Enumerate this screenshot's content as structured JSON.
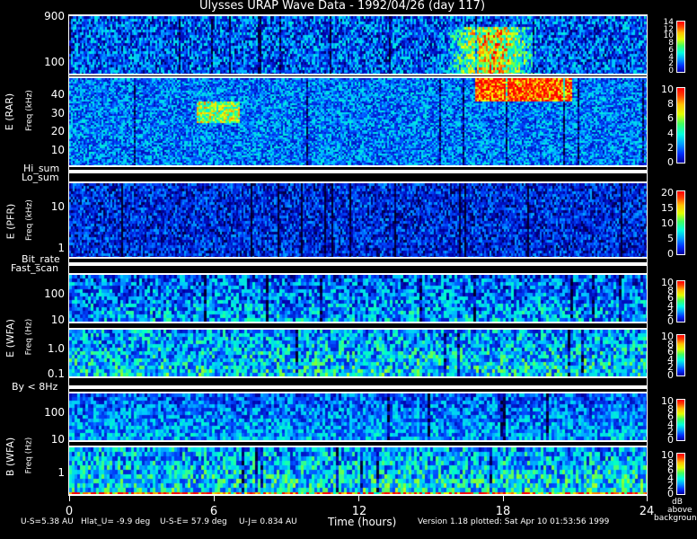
{
  "title": "Ulysses URAP Wave Data - 1992/04/26  (day 117)",
  "chart_data": {
    "type": "heatmap",
    "title": "Ulysses URAP Wave Data - 1992/04/26  (day 117)",
    "xlabel": "Time (hours)",
    "xlim": [
      0,
      24
    ],
    "xticks": [
      "0",
      "6",
      "12",
      "18",
      "24"
    ],
    "colorbar_unit": [
      "dB",
      "above",
      "background"
    ],
    "panels": [
      {
        "name": "E (RAR) high",
        "ylabel": "E (RAR)",
        "yunit": "Freq (kHz)",
        "yticks": [
          "900",
          "100"
        ],
        "cbar_ticks": [
          "0",
          "2",
          "4",
          "6",
          "8",
          "10",
          "12",
          "14"
        ],
        "crange": [
          0,
          14
        ]
      },
      {
        "name": "E (RAR) low",
        "ylabel": "E (RAR)",
        "yunit": "Freq (kHz)",
        "yticks": [
          "40",
          "30",
          "20",
          "10"
        ],
        "cbar_ticks": [
          "0",
          "2",
          "4",
          "6",
          "8",
          "10"
        ],
        "crange": [
          0,
          10
        ]
      },
      {
        "name": "E (PFR)",
        "ylabel": "E (PFR)",
        "yunit": "Freq (kHz)",
        "yticks": [
          "10",
          "1"
        ],
        "cbar_ticks": [
          "0",
          "5",
          "10",
          "15",
          "20"
        ],
        "crange": [
          0,
          20
        ]
      },
      {
        "name": "E (WFA) high",
        "ylabel": "E (WFA)",
        "yunit": "Freq (Hz)",
        "yticks": [
          "100",
          "10"
        ],
        "cbar_ticks": [
          "0",
          "2",
          "4",
          "6",
          "8",
          "10"
        ],
        "crange": [
          0,
          10
        ]
      },
      {
        "name": "E (WFA) low",
        "ylabel": "E (WFA)",
        "yunit": "Freq (Hz)",
        "yticks": [
          "1.0",
          "0.1"
        ],
        "cbar_ticks": [
          "0",
          "2",
          "4",
          "6",
          "8",
          "10"
        ],
        "crange": [
          0,
          10
        ]
      },
      {
        "name": "B (WFA) high",
        "ylabel": "B (WFA)",
        "yunit": "Freq (Hz)",
        "yticks": [
          "100",
          "10"
        ],
        "cbar_ticks": [
          "0",
          "2",
          "4",
          "6",
          "8",
          "10"
        ],
        "crange": [
          0,
          10
        ]
      },
      {
        "name": "B (WFA) low",
        "ylabel": "B (WFA)",
        "yunit": "Freq (Hz)",
        "yticks": [
          "1"
        ],
        "cbar_ticks": [
          "0",
          "2",
          "4",
          "6",
          "8",
          "10"
        ],
        "crange": [
          0,
          10
        ]
      }
    ],
    "status_bars": [
      "Hi_sum",
      "Lo_sum",
      "Bit_rate",
      "Fast_scan",
      "By < 8Hz"
    ]
  },
  "footer": {
    "us": "U-S=5.38 AU",
    "hlat": "Hlat_U= -9.9 deg",
    "use": "U-S-E= 57.9 deg",
    "uj": "U-J= 0.834 AU",
    "version": "Version 1.18 plotted: Sat Apr 10 01:53:56 1999"
  },
  "colors": {
    "background": "#000000",
    "axes": "#ffffff"
  }
}
